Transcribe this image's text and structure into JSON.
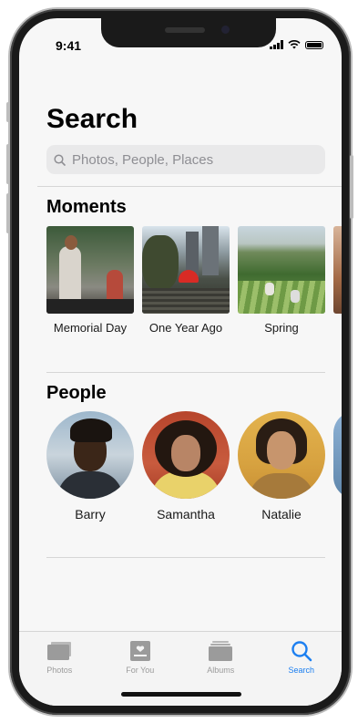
{
  "status_bar": {
    "time": "9:41"
  },
  "header": {
    "title": "Search"
  },
  "search": {
    "placeholder": "Photos, People, Places"
  },
  "moments": {
    "title": "Moments",
    "items": [
      {
        "label": "Memorial Day"
      },
      {
        "label": "One Year Ago"
      },
      {
        "label": "Spring"
      }
    ]
  },
  "people": {
    "title": "People",
    "items": [
      {
        "name": "Barry"
      },
      {
        "name": "Samantha"
      },
      {
        "name": "Natalie"
      }
    ]
  },
  "tabbar": {
    "tabs": [
      {
        "label": "Photos",
        "icon": "photos-icon"
      },
      {
        "label": "For You",
        "icon": "for-you-icon"
      },
      {
        "label": "Albums",
        "icon": "albums-icon"
      },
      {
        "label": "Search",
        "icon": "search-icon"
      }
    ],
    "active": "Search"
  },
  "colors": {
    "accent": "#1c7ff0",
    "tab_inactive": "#9b9b9b",
    "search_bg": "#e9e9ea"
  }
}
